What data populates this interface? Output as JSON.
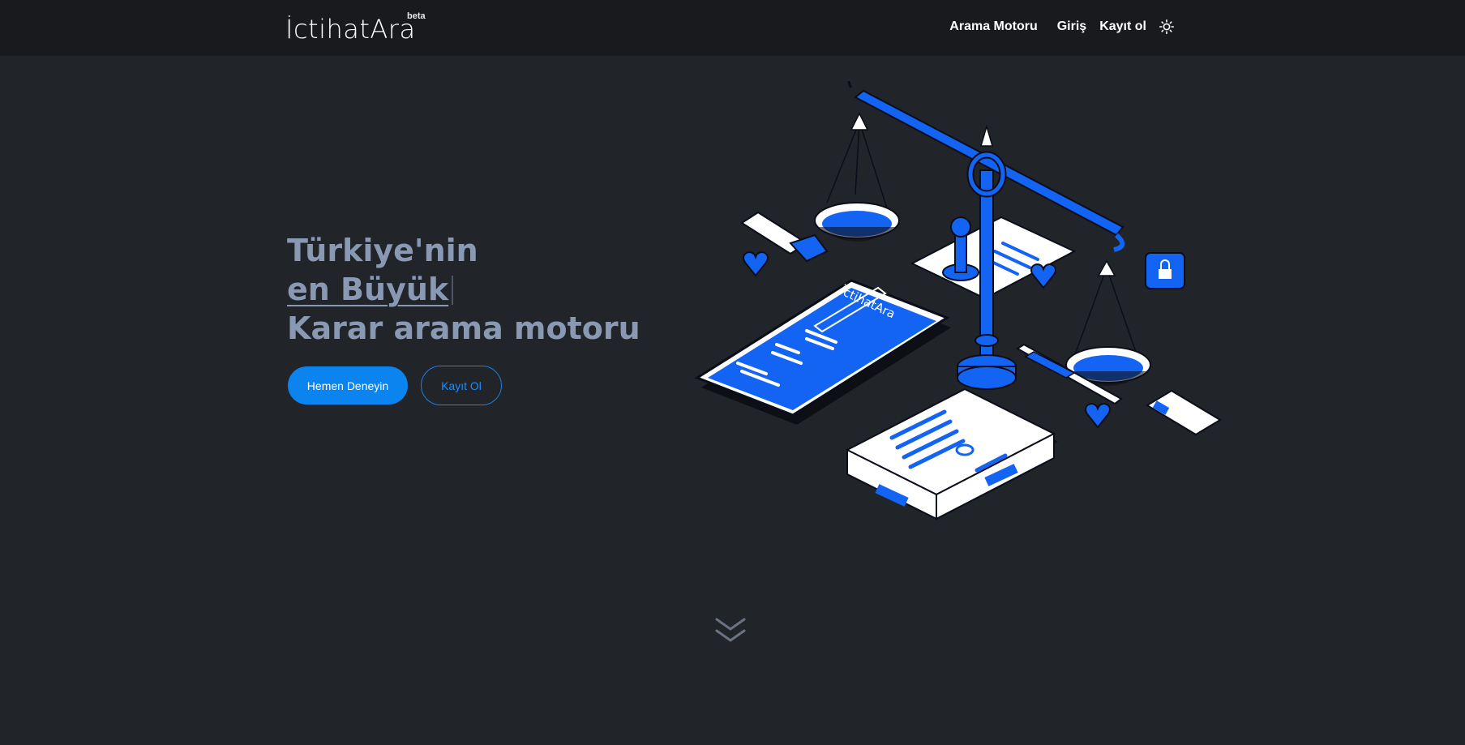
{
  "navbar": {
    "logo_text": "İctihatAra",
    "logo_badge": "beta",
    "links": {
      "search_engine": "Arama Motoru",
      "login": "Giriş",
      "register": "Kayıt ol"
    },
    "theme_toggle_icon": "sun-icon"
  },
  "hero": {
    "line1": "Türkiye'nin",
    "line2": "en Büyük",
    "line3": "Karar arama motoru",
    "primary_button": "Hemen Deneyin",
    "secondary_button": "Kayıt Ol"
  },
  "illustration": {
    "phone_brand": "İctihatAra"
  },
  "scroll_icon": "chevron-double-down-icon",
  "colors": {
    "background": "#212429",
    "navbar": "#181a1d",
    "accent": "#0b84f0",
    "hero_text": "#8a99b3",
    "illustration_blue": "#1464f4"
  }
}
